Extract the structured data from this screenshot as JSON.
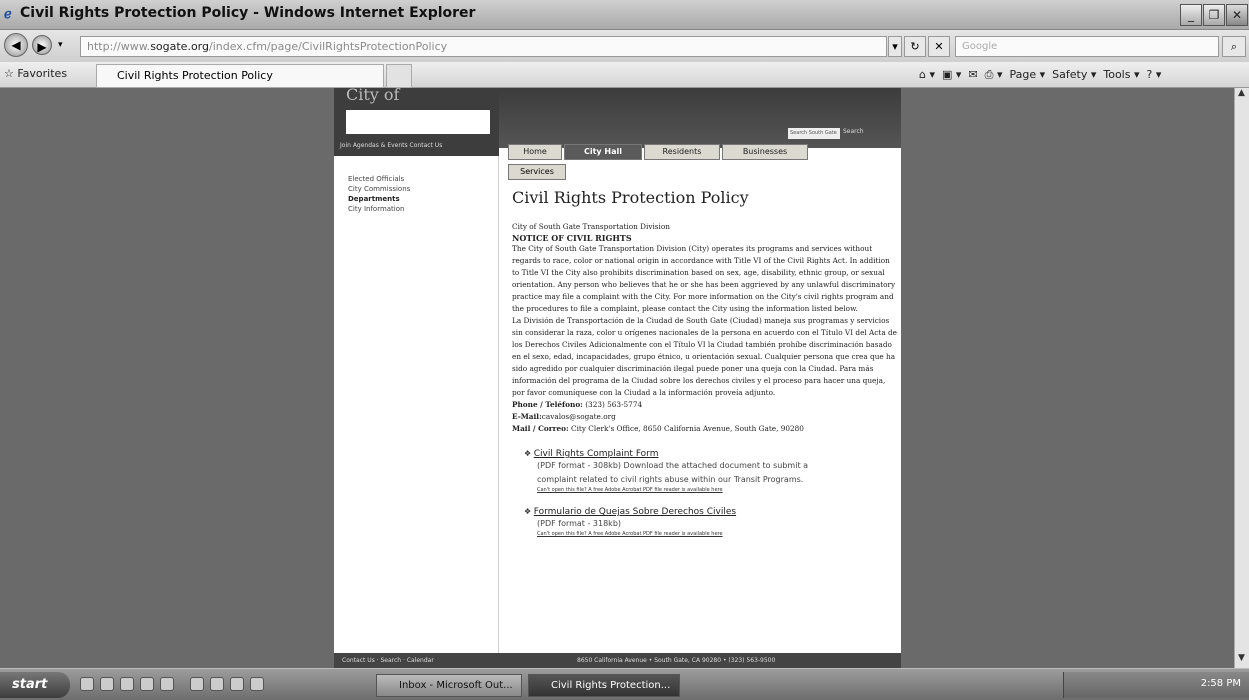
{
  "window": {
    "title": "Civil Rights Protection Policy - Windows Internet Explorer"
  },
  "browser": {
    "address_prefix": "http://www.",
    "address_domain": "sogate.org",
    "address_rest": "/index.cfm/page/CivilRightsProtectionPolicy",
    "search_placeholder": "Google",
    "favorites_label": "Favorites",
    "tab_label": "Civil Rights Protection Policy",
    "cmd_page": "Page ▾",
    "cmd_safety": "Safety ▾",
    "cmd_tools": "Tools ▾"
  },
  "site": {
    "city_word": "City of",
    "header_links": "Join Agendas & Events  Contact Us",
    "search_placeholder": "Search South Gate",
    "search_button": "Search",
    "tabs": [
      "Home",
      "City Hall",
      "Residents",
      "Businesses"
    ],
    "tab_services": "Services",
    "sidebar": [
      "Elected Officials",
      "City Commissions",
      "Departments",
      "City Information"
    ],
    "footer_left": "Contact Us  ·  Search  ·  Calendar",
    "footer_right": "8650 California Avenue • South Gate, CA 90280 • (323) 563-9500"
  },
  "content": {
    "heading": "Civil Rights Protection Policy",
    "division": "City of South Gate Transportation Division",
    "notice": "NOTICE OF CIVIL RIGHTS",
    "para_en": "The City of South Gate Transportation Division (City) operates its programs and services without regards to race, color or national origin in accordance with Title VI of the Civil Rights Act. In addition to Title VI the City also prohibits discrimination based on sex, age, disability, ethnic group, or sexual orientation. Any person who believes that he or she has been aggrieved by any unlawful discriminatory practice may file a complaint with the City. For more information on the City's civil rights program and the procedures to file a complaint, please contact the City using the information listed below.",
    "para_es": "La División de Transportación de la Ciudad de South Gate (Ciudad) maneja sus programas y servicios sin considerar la raza, color u orígenes nacionales de la persona en acuerdo con el Título VI del Acta de los Derechos Civiles Adicionalmente con el Título VI la Ciudad también prohíbe discriminación basado en el sexo, edad, incapacidades, grupo étnico, u orientación sexual. Cualquier persona que crea que ha sido agredido por cualquier discriminación ilegal puede poner una queja con la Ciudad. Para más información del programa de la Ciudad sobre los derechos civiles y el proceso para hacer una queja, por favor comuníquese con la Ciudad a la información proveía adjunto.",
    "phone_label": "Phone / Teléfono:",
    "phone_value": "(323) 563-5774",
    "email_label": "E-Mail:",
    "email_value": "cavalos@sogate.org",
    "mail_label": "Mail / Correo:",
    "mail_value": "City Clerk's Office, 8650 California Avenue, South Gate, 90280",
    "docs": [
      {
        "title": "Civil Rights Complaint Form",
        "desc1": "(PDF format - 308kb) Download the attached document to submit a",
        "desc2": "complaint related to civil rights abuse within our Transit Programs.",
        "note": "Can't open this file? A free Adobe Acrobat PDF file reader is available here"
      },
      {
        "title": "Formulario de Quejas Sobre Derechos Civiles",
        "desc1": "(PDF format - 318kb)",
        "desc2": "",
        "note": "Can't open this file? A free Adobe Acrobat PDF file reader is available here"
      }
    ]
  },
  "taskbar": {
    "start": "start",
    "task1": "Inbox - Microsoft Out...",
    "task2": "Civil Rights Protection...",
    "clock": "2:58 PM"
  }
}
